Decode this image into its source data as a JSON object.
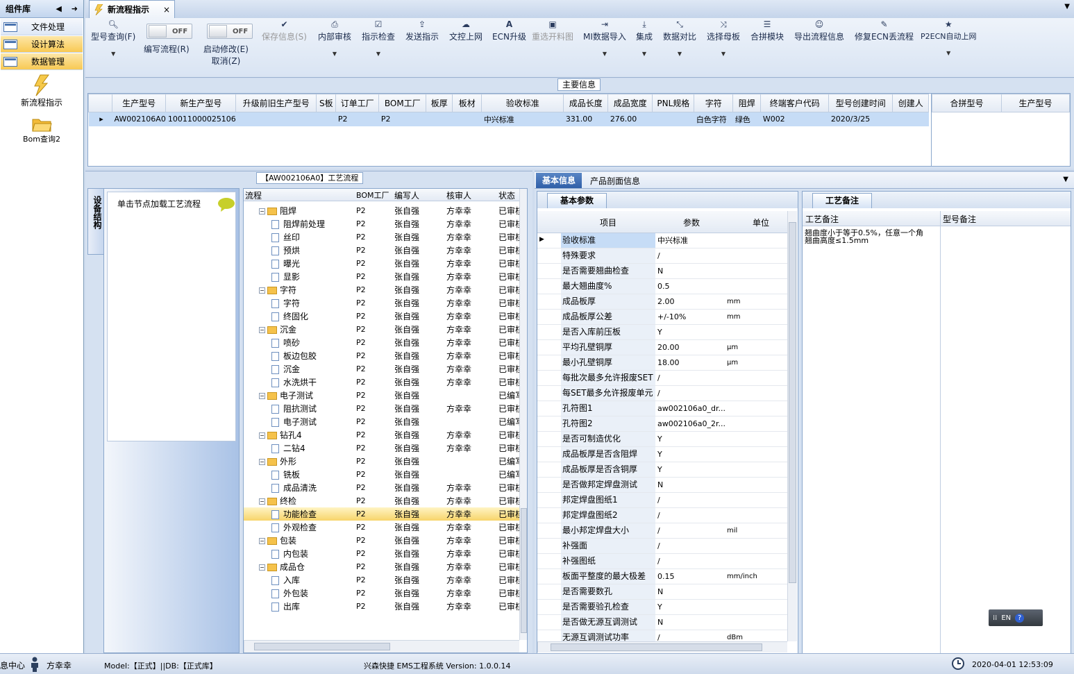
{
  "sidebar": {
    "title": "组件库",
    "groups": [
      {
        "label": "文件处理"
      },
      {
        "label": "设计算法"
      },
      {
        "label": "数据管理"
      }
    ],
    "items": [
      {
        "label": "新流程指示"
      },
      {
        "label": "Bom查询2"
      }
    ]
  },
  "doc_tab": {
    "label": "新流程指示",
    "close": "×"
  },
  "toolbar": {
    "items": [
      {
        "label": "型号查询(F)",
        "icon": "search-icon"
      },
      {
        "label": "编写流程(R)",
        "toggle": "OFF"
      },
      {
        "label": "启动修改(E)",
        "label2": "取消(Z)",
        "toggle": "OFF"
      },
      {
        "label": "保存信息(S)",
        "icon": "check-icon"
      },
      {
        "label": "内部审核",
        "icon": "print-icon"
      },
      {
        "label": "指示检查",
        "icon": "checkbox-icon"
      },
      {
        "label": "发送指示",
        "icon": "upload-icon"
      },
      {
        "label": "文控上网",
        "icon": "cloud-upload-icon"
      },
      {
        "label": "ECN升级",
        "icon": "font-icon"
      },
      {
        "label": "重选开料图",
        "icon": "image-icon"
      },
      {
        "label": "MI数据导入",
        "icon": "import-icon"
      },
      {
        "label": "集成",
        "icon": "download-icon"
      },
      {
        "label": "数据对比",
        "icon": "compress-icon"
      },
      {
        "label": "选择母板",
        "icon": "shuffle-icon"
      },
      {
        "label": "合拼模块",
        "icon": "list-icon"
      },
      {
        "label": "导出流程信息",
        "icon": "smile-icon"
      },
      {
        "label": "修复ECN丢流程",
        "icon": "wrench-icon"
      },
      {
        "label": "P2ECN自动上网",
        "icon": "star-icon"
      }
    ]
  },
  "main_info": {
    "title": "主要信息",
    "columns": [
      "生产型号",
      "新生产型号",
      "升级前旧生产型号",
      "S板",
      "订单工厂",
      "BOM工厂",
      "板厚",
      "板材",
      "验收标准",
      "成品长度",
      "成品宽度",
      "PNL规格",
      "字符",
      "阻焊",
      "终端客户代码",
      "型号创建时间",
      "创建人"
    ],
    "row": [
      "AW002106A0",
      "10011000025106",
      "",
      "",
      "P2",
      "P2",
      "",
      "",
      "中兴标准",
      "331.00",
      "276.00",
      "",
      "白色字符",
      "绿色",
      "W002",
      "2020/3/25",
      ""
    ],
    "side_columns": [
      "合拼型号",
      "生产型号"
    ]
  },
  "process": {
    "title": "【AW002106A0】工艺流程",
    "side_tab": "设备结构",
    "hint": "单击节点加载工艺流程",
    "columns": [
      "流程",
      "BOM工厂",
      "编写人",
      "核审人",
      "状态"
    ],
    "rows": [
      {
        "name": "阻焊",
        "lvl": 0,
        "bom": "P2",
        "w": "张自强",
        "r": "方幸幸",
        "s": "已审核"
      },
      {
        "name": "阻焊前处理",
        "lvl": 1,
        "bom": "P2",
        "w": "张自强",
        "r": "方幸幸",
        "s": "已审核"
      },
      {
        "name": "丝印",
        "lvl": 1,
        "bom": "P2",
        "w": "张自强",
        "r": "方幸幸",
        "s": "已审核"
      },
      {
        "name": "预烘",
        "lvl": 1,
        "bom": "P2",
        "w": "张自强",
        "r": "方幸幸",
        "s": "已审核"
      },
      {
        "name": "曝光",
        "lvl": 1,
        "bom": "P2",
        "w": "张自强",
        "r": "方幸幸",
        "s": "已审核"
      },
      {
        "name": "显影",
        "lvl": 1,
        "bom": "P2",
        "w": "张自强",
        "r": "方幸幸",
        "s": "已审核"
      },
      {
        "name": "字符",
        "lvl": 0,
        "bom": "P2",
        "w": "张自强",
        "r": "方幸幸",
        "s": "已审核"
      },
      {
        "name": "字符",
        "lvl": 1,
        "bom": "P2",
        "w": "张自强",
        "r": "方幸幸",
        "s": "已审核"
      },
      {
        "name": "终固化",
        "lvl": 1,
        "bom": "P2",
        "w": "张自强",
        "r": "方幸幸",
        "s": "已审核"
      },
      {
        "name": "沉金",
        "lvl": 0,
        "bom": "P2",
        "w": "张自强",
        "r": "方幸幸",
        "s": "已审核"
      },
      {
        "name": "喷砂",
        "lvl": 1,
        "bom": "P2",
        "w": "张自强",
        "r": "方幸幸",
        "s": "已审核"
      },
      {
        "name": "板边包胶",
        "lvl": 1,
        "bom": "P2",
        "w": "张自强",
        "r": "方幸幸",
        "s": "已审核"
      },
      {
        "name": "沉金",
        "lvl": 1,
        "bom": "P2",
        "w": "张自强",
        "r": "方幸幸",
        "s": "已审核"
      },
      {
        "name": "水洗烘干",
        "lvl": 1,
        "bom": "P2",
        "w": "张自强",
        "r": "方幸幸",
        "s": "已审核"
      },
      {
        "name": "电子测试",
        "lvl": 0,
        "bom": "P2",
        "w": "张自强",
        "r": "",
        "s": "已编写"
      },
      {
        "name": "阻抗测试",
        "lvl": 1,
        "bom": "P2",
        "w": "张自强",
        "r": "方幸幸",
        "s": "已审核"
      },
      {
        "name": "电子测试",
        "lvl": 1,
        "bom": "P2",
        "w": "张自强",
        "r": "",
        "s": "已编写"
      },
      {
        "name": "钻孔4",
        "lvl": 0,
        "bom": "P2",
        "w": "张自强",
        "r": "方幸幸",
        "s": "已审核"
      },
      {
        "name": "二钻4",
        "lvl": 1,
        "bom": "P2",
        "w": "张自强",
        "r": "方幸幸",
        "s": "已审核"
      },
      {
        "name": "外形",
        "lvl": 0,
        "bom": "P2",
        "w": "张自强",
        "r": "",
        "s": "已编写"
      },
      {
        "name": "铣板",
        "lvl": 1,
        "bom": "P2",
        "w": "张自强",
        "r": "",
        "s": "已编写"
      },
      {
        "name": "成品清洗",
        "lvl": 1,
        "bom": "P2",
        "w": "张自强",
        "r": "方幸幸",
        "s": "已审核"
      },
      {
        "name": "终检",
        "lvl": 0,
        "bom": "P2",
        "w": "张自强",
        "r": "方幸幸",
        "s": "已审核"
      },
      {
        "name": "功能检查",
        "lvl": 1,
        "bom": "P2",
        "w": "张自强",
        "r": "方幸幸",
        "s": "已审核",
        "sel": true
      },
      {
        "name": "外观检查",
        "lvl": 1,
        "bom": "P2",
        "w": "张自强",
        "r": "方幸幸",
        "s": "已审核"
      },
      {
        "name": "包装",
        "lvl": 0,
        "bom": "P2",
        "w": "张自强",
        "r": "方幸幸",
        "s": "已审核"
      },
      {
        "name": "内包装",
        "lvl": 1,
        "bom": "P2",
        "w": "张自强",
        "r": "方幸幸",
        "s": "已审核"
      },
      {
        "name": "成品仓",
        "lvl": 0,
        "bom": "P2",
        "w": "张自强",
        "r": "方幸幸",
        "s": "已审核"
      },
      {
        "name": "入库",
        "lvl": 1,
        "bom": "P2",
        "w": "张自强",
        "r": "方幸幸",
        "s": "已审核"
      },
      {
        "name": "外包装",
        "lvl": 1,
        "bom": "P2",
        "w": "张自强",
        "r": "方幸幸",
        "s": "已审核"
      },
      {
        "name": "出库",
        "lvl": 1,
        "bom": "P2",
        "w": "张自强",
        "r": "方幸幸",
        "s": "已审核"
      }
    ]
  },
  "right_tabs": [
    "基本信息",
    "产品剖面信息"
  ],
  "params": {
    "tab": "基本参数",
    "columns": [
      "项目",
      "参数",
      "单位"
    ],
    "rows": [
      [
        "验收标准",
        "中兴标准",
        ""
      ],
      [
        "特殊要求",
        "/",
        ""
      ],
      [
        "是否需要翘曲检查",
        "N",
        ""
      ],
      [
        "最大翘曲度%",
        "0.5",
        ""
      ],
      [
        "成品板厚",
        "2.00",
        "mm"
      ],
      [
        "成品板厚公差",
        "+/-10%",
        "mm"
      ],
      [
        "是否入库前压板",
        "Y",
        ""
      ],
      [
        "平均孔壁铜厚",
        "20.00",
        "μm"
      ],
      [
        "最小孔壁铜厚",
        "18.00",
        "μm"
      ],
      [
        "每批次最多允许报废SET",
        "/",
        ""
      ],
      [
        "每SET最多允许报废单元",
        "/",
        ""
      ],
      [
        "孔符图1",
        "aw002106a0_dr...",
        ""
      ],
      [
        "孔符图2",
        "aw002106a0_2r...",
        ""
      ],
      [
        "是否可制造优化",
        "Y",
        ""
      ],
      [
        "成品板厚是否含阻焊",
        "Y",
        ""
      ],
      [
        "成品板厚是否含铜厚",
        "Y",
        ""
      ],
      [
        "是否做邦定焊盘测试",
        "N",
        ""
      ],
      [
        "邦定焊盘图纸1",
        "/",
        ""
      ],
      [
        "邦定焊盘图纸2",
        "/",
        ""
      ],
      [
        "最小邦定焊盘大小",
        "/",
        "mil"
      ],
      [
        "补强面",
        "/",
        ""
      ],
      [
        "补强图纸",
        "/",
        ""
      ],
      [
        "板面平整度的最大极差",
        "0.15",
        "mm/inch"
      ],
      [
        "是否需要数孔",
        "N",
        ""
      ],
      [
        "是否需要验孔检查",
        "Y",
        ""
      ],
      [
        "是否做无源互调测试",
        "N",
        ""
      ],
      [
        "无源互调测试功率",
        "/",
        "dBm"
      ]
    ]
  },
  "remarks": {
    "tab": "工艺备注",
    "col1": "工艺备注",
    "col2": "型号备注",
    "text": "翘曲度小于等于0.5%，任意一个角翘曲高度≤1.5mm"
  },
  "ime": {
    "lang": "EN"
  },
  "status": {
    "left": "息中心",
    "user": "方幸幸",
    "model": "Model:【正式】||DB:【正式库】",
    "app": "兴森快捷 EMS工程系统 Version: 1.0.0.14",
    "time": "2020-04-01 12:53:09"
  }
}
